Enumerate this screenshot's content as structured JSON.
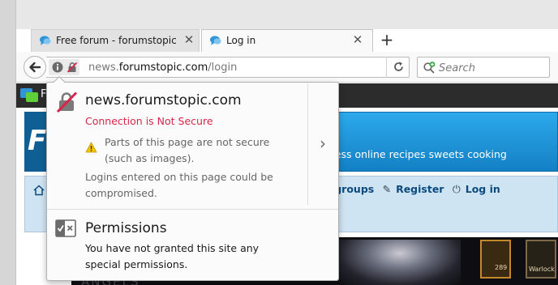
{
  "tabs": [
    {
      "label": "Free forum - forumstopic....",
      "active": false,
      "close_glyph": "✕",
      "icon": "forum-chat-bubbles-icon"
    },
    {
      "label": "Log in",
      "active": true,
      "close_glyph": "✕",
      "icon": "forum-chat-bubbles-icon"
    }
  ],
  "new_tab_glyph": "+",
  "urlbar": {
    "prefix": "news.",
    "host": "forumstopic.com",
    "path": "/login"
  },
  "searchbar": {
    "placeholder": "Search"
  },
  "identity_popup": {
    "host": "news.forumstopic.com",
    "status": "Connection is Not Secure",
    "mixed_content_warning": "Parts of this page are not secure (such as images).",
    "logins_warning": "Logins entered on this page could be compromised.",
    "permissions_title": "Permissions",
    "permissions_text": "You have not granted this site any special permissions.",
    "chevron_glyph": "›"
  },
  "webpage": {
    "nav_visible_letter": "F",
    "header_visible_letter": "F",
    "tagline": "dress online recipes sweets cooking",
    "navlinks": [
      {
        "label": "Usergroups",
        "icon": "usergroups-icon"
      },
      {
        "label": "Register",
        "icon": "register-icon"
      },
      {
        "label": "Log in",
        "icon": "login-icon"
      }
    ],
    "art_caption": "ANGELS",
    "art_slot_label": "289",
    "art_slot2_label": "Warlock"
  },
  "colors": {
    "insecure_red": "#d7264a",
    "warning_yellow": "#f5c400",
    "header_blue": "#1e93d8",
    "tab_icon_blue": "#2e96d8"
  }
}
